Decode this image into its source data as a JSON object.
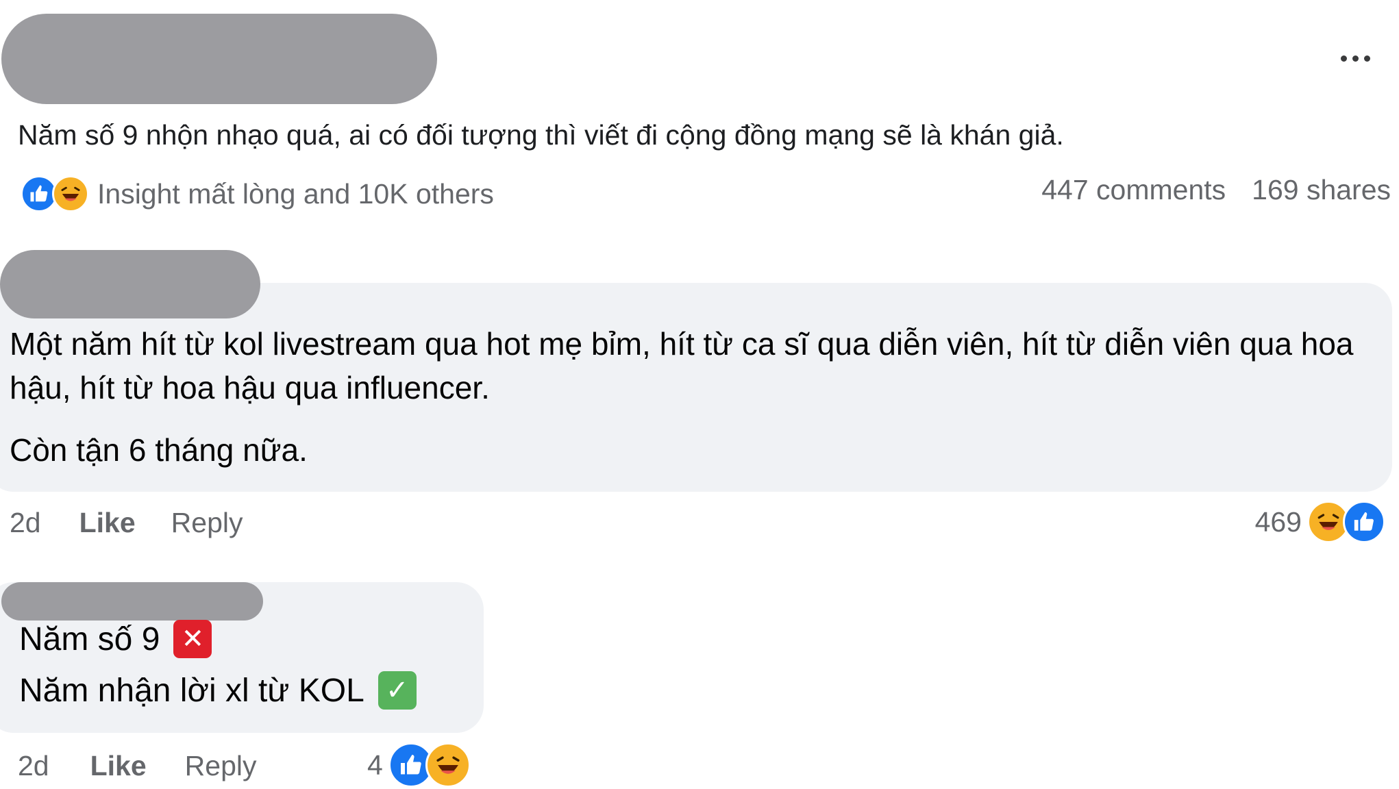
{
  "post": {
    "text": "Năm số 9 nhộn nhạo quá, ai có đối tượng thì viết đi cộng đồng mạng sẽ là khán giả.",
    "reactions_text": "Insight mất lòng and 10K others",
    "comments_count": "447 comments",
    "shares_count": "169 shares"
  },
  "comment1": {
    "text_line1": "Một năm hít từ kol livestream qua hot mẹ bỉm, hít từ ca sĩ qua diễn viên, hít từ diễn viên qua hoa hậu, hít từ hoa hậu qua influencer.",
    "text_line2": "Còn tận 6 tháng nữa.",
    "time": "2d",
    "like_label": "Like",
    "reply_label": "Reply",
    "reaction_count": "469"
  },
  "comment2": {
    "line1": "Năm số 9",
    "line2": "Năm nhận lời xl từ KOL",
    "time": "2d",
    "like_label": "Like",
    "reply_label": "Reply",
    "reaction_count": "4"
  },
  "icons": {
    "like": "like-icon",
    "haha": "haha-icon",
    "more": "more-options-icon",
    "cross_mark": "cross-mark-icon",
    "check_mark": "check-mark-icon"
  },
  "colors": {
    "like_blue": "#1877f2",
    "haha_yellow": "#f7b125",
    "bubble_gray": "#f0f2f5",
    "muted_text": "#65676b",
    "redaction_gray": "#9c9ca0"
  }
}
